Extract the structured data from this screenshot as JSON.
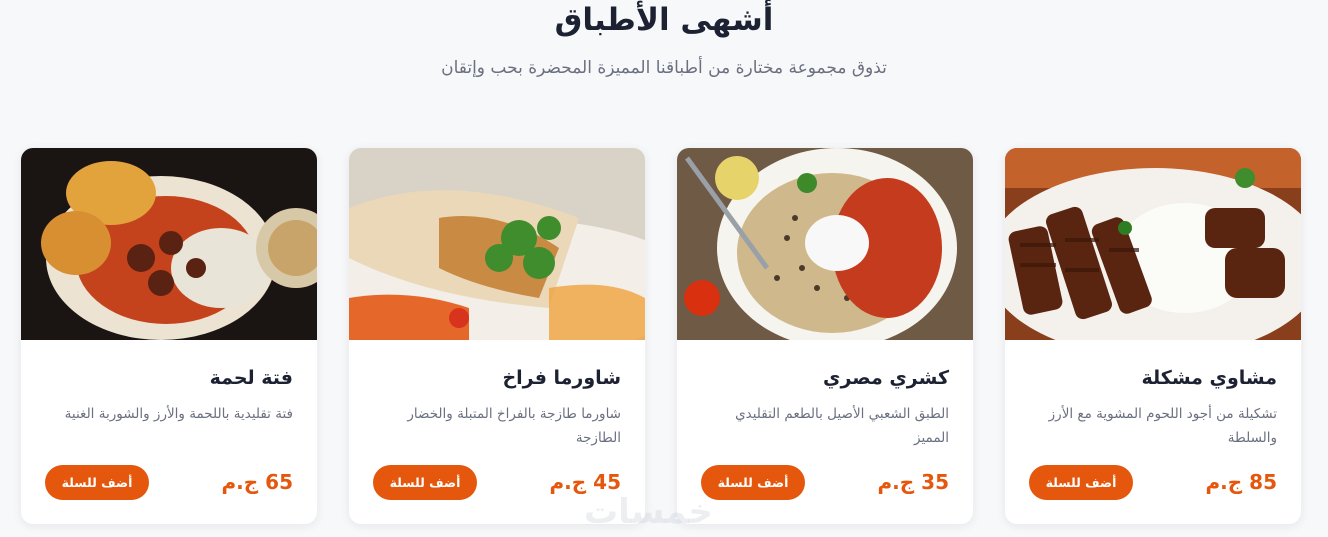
{
  "section": {
    "title": "أشهى الأطباق",
    "subtitle": "تذوق مجموعة مختارة من أطباقنا المميزة المحضرة بحب وإتقان"
  },
  "dishes": [
    {
      "name": "مشاوي مشكلة",
      "description": "تشكيلة من أجود اللحوم المشوية مع الأرز والسلطة",
      "price": "85 ج.م",
      "button": "أضف للسلة",
      "image": "mixed-grill-photo"
    },
    {
      "name": "كشري مصري",
      "description": "الطبق الشعبي الأصيل بالطعم التقليدي المميز",
      "price": "35 ج.م",
      "button": "أضف للسلة",
      "image": "koshari-photo"
    },
    {
      "name": "شاورما فراخ",
      "description": "شاورما طازجة بالفراخ المتبلة والخضار الطازجة",
      "price": "45 ج.م",
      "button": "أضف للسلة",
      "image": "chicken-shawarma-photo"
    },
    {
      "name": "فتة لحمة",
      "description": "فتة تقليدية باللحمة والأرز والشوربة الغنية",
      "price": "65 ج.م",
      "button": "أضف للسلة",
      "image": "fatta-photo"
    }
  ],
  "watermark": "خمسات",
  "colors": {
    "accent": "#e4570c",
    "background": "#f7f8fa",
    "title": "#1d2233",
    "muted": "#6b7080"
  }
}
